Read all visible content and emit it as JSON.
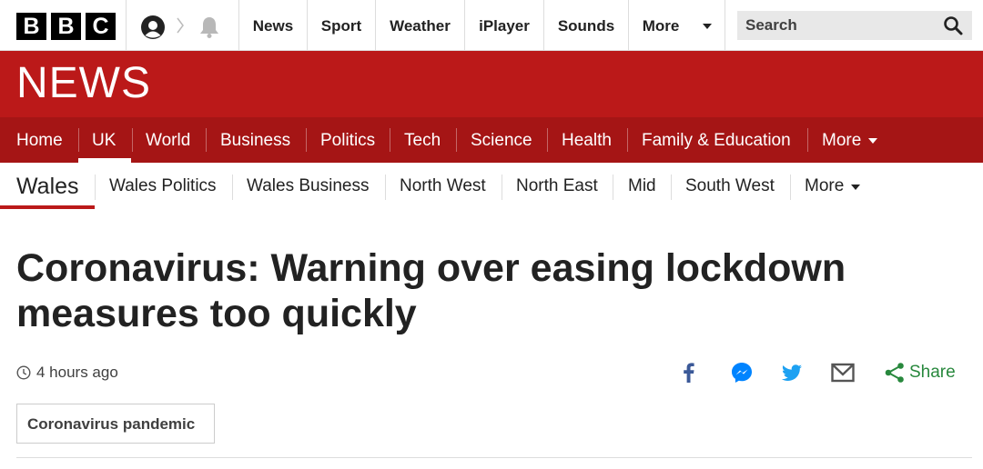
{
  "top_nav": {
    "logo_letters": [
      "B",
      "B",
      "C"
    ],
    "account_icon": "account-icon",
    "notification_icon": "bell-icon",
    "links": [
      "News",
      "Sport",
      "Weather",
      "iPlayer",
      "Sounds",
      "More"
    ],
    "search_placeholder": "Search",
    "search_icon": "search-icon"
  },
  "brand": {
    "logo_text": "NEWS",
    "color": "#bb1919"
  },
  "primary_nav": {
    "items": [
      "Home",
      "UK",
      "World",
      "Business",
      "Politics",
      "Tech",
      "Science",
      "Health",
      "Family & Education",
      "More"
    ],
    "active": "UK"
  },
  "secondary_nav": {
    "section": "Wales",
    "items": [
      "Wales Politics",
      "Wales Business",
      "North West",
      "North East",
      "Mid",
      "South West",
      "More"
    ]
  },
  "article": {
    "headline_line1": "Coronavirus: Warning over easing lockdown",
    "headline_line2": "measures too quickly",
    "timestamp": "4 hours ago",
    "share_label": "Share",
    "share_icons": [
      "facebook-icon",
      "messenger-icon",
      "twitter-icon",
      "email-icon",
      "share-icon"
    ],
    "tag": "Coronavirus pandemic"
  }
}
